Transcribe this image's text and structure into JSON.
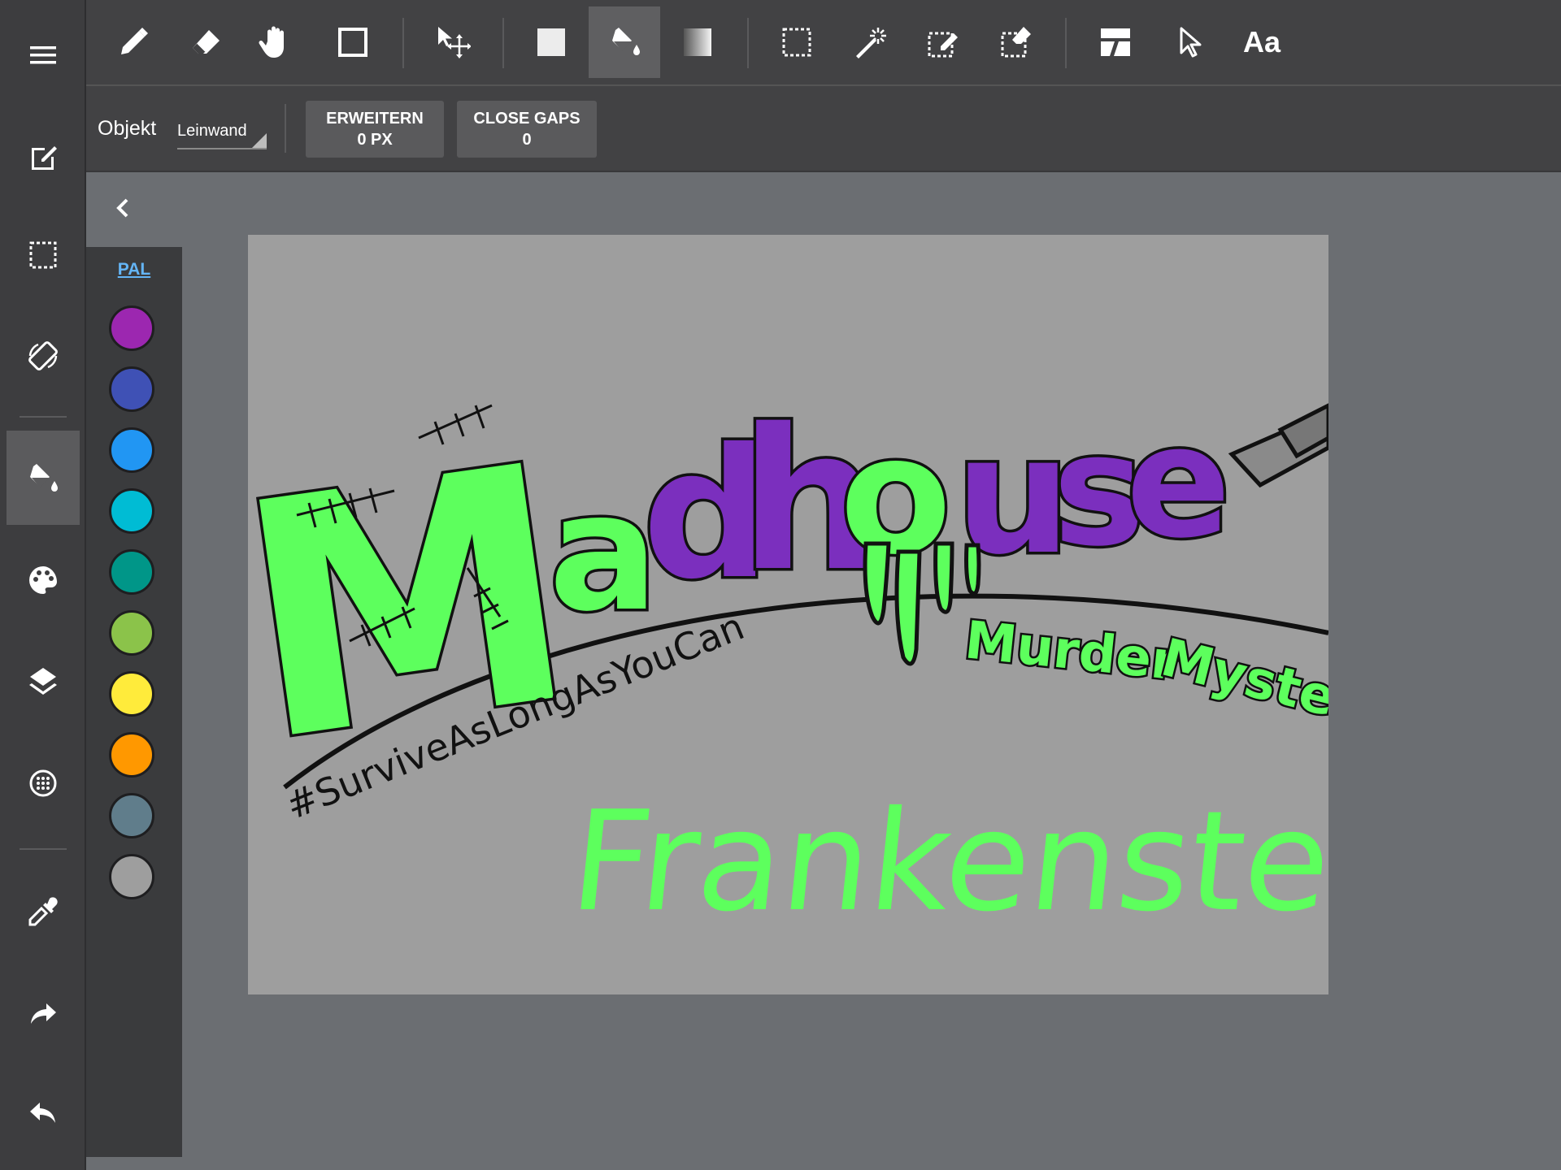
{
  "toolbar": {
    "tools": [
      "pencil-icon",
      "eraser-icon",
      "hand-icon",
      "rectangle-icon",
      "move-icon",
      "fill-color-icon",
      "bucket-icon",
      "gradient-icon",
      "select-rect-icon",
      "magic-wand-icon",
      "select-pen-icon",
      "select-eraser-icon",
      "panel-icon",
      "pointer-icon"
    ],
    "text_tool_label": "Aa",
    "active_tool": "bucket-icon"
  },
  "options": {
    "target_label": "Objekt",
    "target_value": "Leinwand",
    "expand_label": "ERWEITERN",
    "expand_value": "0 PX",
    "close_gaps_label": "CLOSE GAPS",
    "close_gaps_value": "0"
  },
  "sidebar": {
    "items": [
      "menu-icon",
      "edit-icon",
      "selection-icon",
      "rotate-icon",
      "bucket-icon",
      "palette-icon",
      "layers-icon",
      "grid-icon",
      "eyedropper-icon",
      "redo-icon",
      "undo-icon"
    ],
    "active": "bucket-icon"
  },
  "palette": {
    "label": "PAL",
    "colors": [
      "#9c27b0",
      "#3f51b5",
      "#2196f3",
      "#00bcd4",
      "#009688",
      "#8bc34a",
      "#ffeb3b",
      "#ff9800",
      "#607d8b",
      "#9e9e9e"
    ]
  },
  "artwork": {
    "title_letters": [
      "M",
      "a",
      "d",
      "h",
      "o",
      "u",
      "s",
      "e"
    ],
    "tagline": "#SurviveAsLongAsYouCan",
    "subtitle_1": "Murder",
    "subtitle_2": "Mystery",
    "name": "Frankenstein",
    "colors": {
      "green": "#5dff5d",
      "purple": "#7b2fbe",
      "outline": "#111111"
    }
  }
}
